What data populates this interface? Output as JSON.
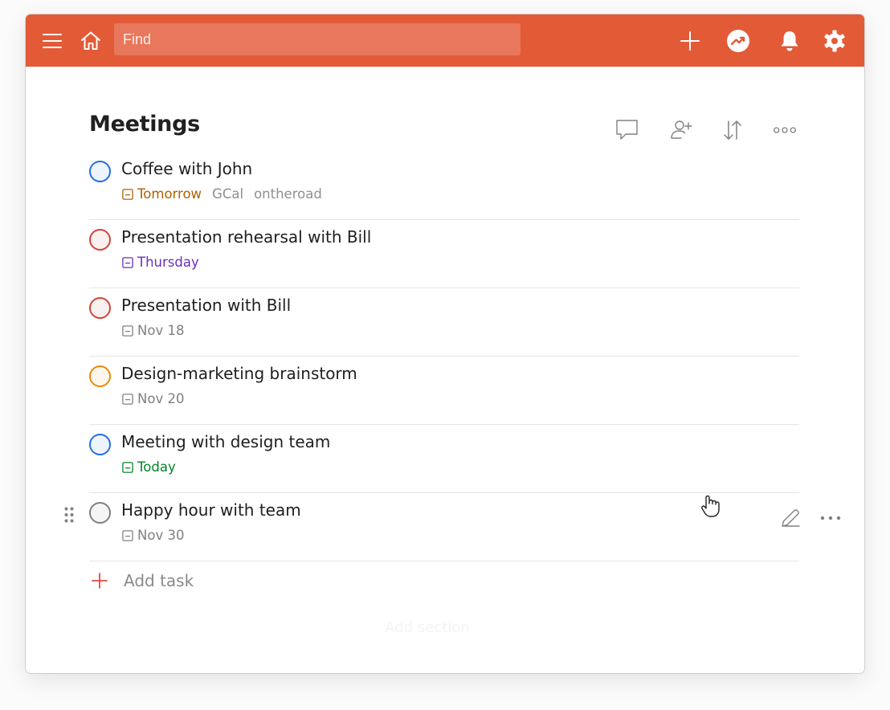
{
  "topbar": {
    "menu_icon": "hamburger-icon",
    "home_icon": "home-icon",
    "search_placeholder": "Find",
    "actions": [
      {
        "icon": "plus-icon"
      },
      {
        "icon": "karma-trend-icon"
      },
      {
        "icon": "bell-icon"
      },
      {
        "icon": "gear-icon"
      }
    ],
    "color": "#e35a37"
  },
  "project": {
    "title": "Meetings",
    "actions": [
      {
        "icon": "comment-icon"
      },
      {
        "icon": "add-person-icon"
      },
      {
        "icon": "sort-icon"
      },
      {
        "icon": "more-icon"
      }
    ]
  },
  "tasks": [
    {
      "name": "Coffee with John",
      "priority_color": "#246fe0",
      "due": "Tomorrow",
      "due_color": "#ad6200",
      "labels": [
        "GCal",
        "ontheroad"
      ]
    },
    {
      "name": "Presentation rehearsal with Bill",
      "priority_color": "#d1453b",
      "due": "Thursday",
      "due_color": "#692fc2",
      "labels": []
    },
    {
      "name": "Presentation with Bill",
      "priority_color": "#d1453b",
      "due": "Nov 18",
      "due_color": "#808080",
      "labels": []
    },
    {
      "name": "Design-marketing brainstorm",
      "priority_color": "#eb8909",
      "due": "Nov 20",
      "due_color": "#808080",
      "labels": []
    },
    {
      "name": "Meeting with design team",
      "priority_color": "#246fe0",
      "due": "Today",
      "due_color": "#058527",
      "labels": []
    },
    {
      "name": "Happy hour with team",
      "priority_color": "#808080",
      "due": "Nov 30",
      "due_color": "#808080",
      "labels": [],
      "hovered": true
    }
  ],
  "add_task_label": "Add task",
  "add_section_label": "Add section",
  "accent_color": "#dc4c3e"
}
